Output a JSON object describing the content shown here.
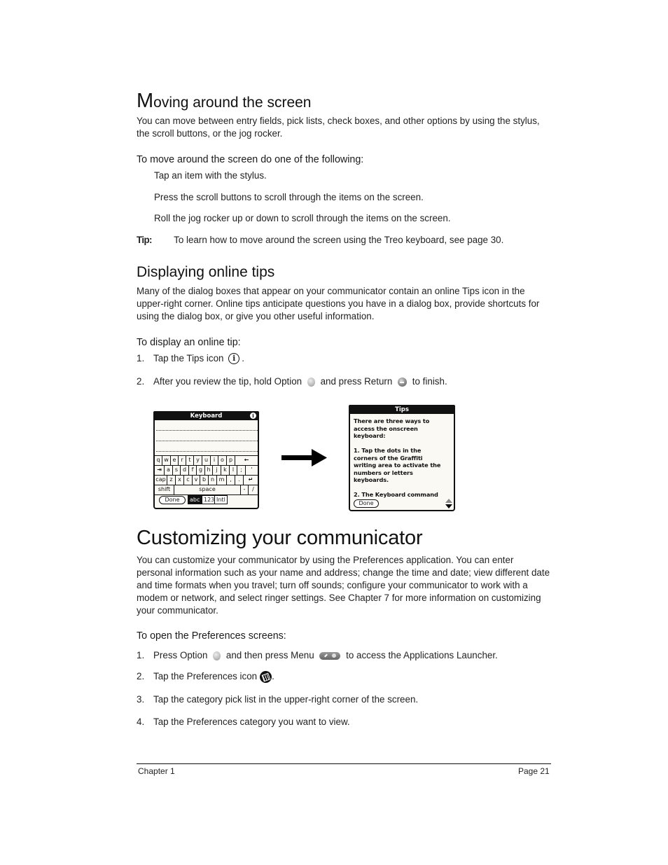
{
  "section1": {
    "title_cap": "M",
    "title_rest": "oving around the screen",
    "intro": "You can move between entry fields, pick lists, check boxes, and other options by using the stylus, the scroll buttons, or the jog rocker.",
    "lead": "To move around the screen do one of the following:",
    "options": [
      "Tap an item with the stylus.",
      "Press the scroll buttons to scroll through the items on the screen.",
      "Roll the jog rocker up or down to scroll through the items on the screen."
    ],
    "tip_label": "Tip:",
    "tip_text": "To learn how to move around the screen using the Treo keyboard, see page 30."
  },
  "section2": {
    "title": "Displaying online tips",
    "intro": "Many of the dialog boxes that appear on your communicator contain an online Tips icon in the upper-right corner. Online tips anticipate questions you have in a dialog box, provide shortcuts for using the dialog box, or give you other useful information.",
    "lead": "To display an online tip:",
    "steps": [
      {
        "num": "1.",
        "before": "Tap the Tips icon",
        "icon": "info-icon",
        "after": "."
      },
      {
        "num": "2.",
        "before": "After you review the tip, hold Option",
        "icon": "option-button-icon",
        "middle": "and press Return",
        "icon2": "return-button-icon",
        "after": "to finish."
      }
    ]
  },
  "keyboard_screen": {
    "title": "Keyboard",
    "rows": [
      [
        "q",
        "w",
        "e",
        "r",
        "t",
        "y",
        "u",
        "i",
        "o",
        "p",
        "←"
      ],
      [
        "⇥",
        "a",
        "s",
        "d",
        "f",
        "g",
        "h",
        "j",
        "k",
        "l",
        ";",
        "'"
      ],
      [
        "cap",
        "z",
        "x",
        "c",
        "v",
        "b",
        "n",
        "m",
        ",",
        ".",
        "↵"
      ],
      [
        "shift",
        "space",
        "-",
        "/"
      ]
    ],
    "done": "Done",
    "modes": [
      "abc",
      "123",
      "Intl"
    ],
    "selected_mode": "abc"
  },
  "tips_screen": {
    "title": "Tips",
    "lines": [
      "There are three ways to",
      "access the onscreen",
      "keyboard:",
      "",
      "1. Tap the dots in the",
      "corners of the Graffiti",
      "writing area to activate the",
      "numbers or letters",
      "keyboards.",
      "",
      "2. The Keyboard command"
    ],
    "done": "Done"
  },
  "section3": {
    "title": "Customizing your communicator",
    "intro": "You can customize your communicator by using the Preferences application. You can enter personal information such as your name and address; change the time and date; view different date and time formats when you travel; turn off sounds; configure your communicator to work with a modem or network, and select ringer settings. See Chapter 7 for more information on customizing your communicator.",
    "lead": "To open the Preferences screens:",
    "steps": [
      {
        "num": "1.",
        "before": "Press Option",
        "middle": "and then press Menu",
        "after": "to access the Applications Launcher."
      },
      {
        "num": "2.",
        "before": "Tap the Preferences icon",
        "after": "."
      },
      {
        "num": "3.",
        "before": "Tap the category pick list in the upper-right corner of the screen."
      },
      {
        "num": "4.",
        "before": "Tap the Preferences category you want to view."
      }
    ]
  },
  "footer": {
    "chapter": "Chapter 1",
    "page": "Page 21"
  }
}
